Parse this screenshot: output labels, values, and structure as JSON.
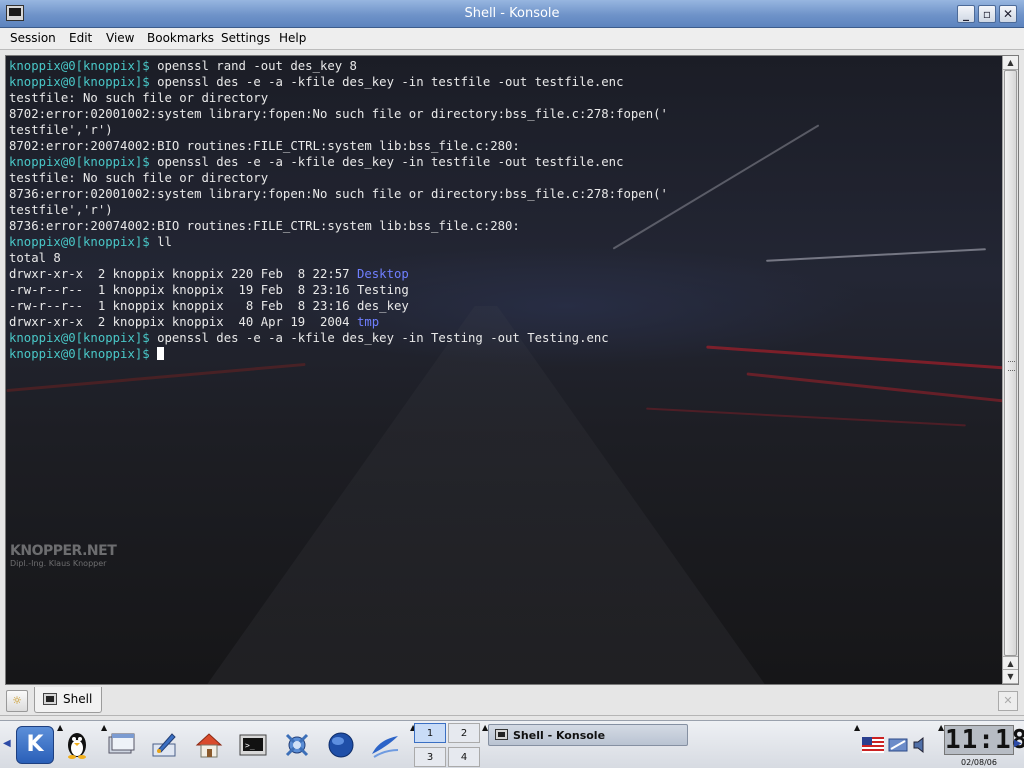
{
  "window": {
    "title": "Shell - Konsole"
  },
  "menubar": {
    "items": [
      "Session",
      "Edit",
      "View",
      "Bookmarks",
      "Settings",
      "Help"
    ]
  },
  "terminal": {
    "prompt": "knoppix@0[knoppix]$",
    "lines": [
      {
        "type": "cmd",
        "text": " openssl rand -out des_key 8"
      },
      {
        "type": "cmd",
        "text": " openssl des -e -a -kfile des_key -in testfile -out testfile.enc"
      },
      {
        "type": "out",
        "text": "testfile: No such file or directory"
      },
      {
        "type": "out",
        "text": "8702:error:02001002:system library:fopen:No such file or directory:bss_file.c:278:fopen('"
      },
      {
        "type": "out",
        "text": "testfile','r')"
      },
      {
        "type": "out",
        "text": "8702:error:20074002:BIO routines:FILE_CTRL:system lib:bss_file.c:280:"
      },
      {
        "type": "cmd",
        "text": " openssl des -e -a -kfile des_key -in testfile -out testfile.enc"
      },
      {
        "type": "out",
        "text": "testfile: No such file or directory"
      },
      {
        "type": "out",
        "text": "8736:error:02001002:system library:fopen:No such file or directory:bss_file.c:278:fopen('"
      },
      {
        "type": "out",
        "text": "testfile','r')"
      },
      {
        "type": "out",
        "text": "8736:error:20074002:BIO routines:FILE_CTRL:system lib:bss_file.c:280:"
      },
      {
        "type": "cmd",
        "text": " ll"
      },
      {
        "type": "out",
        "text": "total 8"
      },
      {
        "type": "ls",
        "text": "drwxr-xr-x  2 knoppix knoppix 220 Feb  8 22:57 ",
        "name": "Desktop",
        "isdir": true
      },
      {
        "type": "ls",
        "text": "-rw-r--r--  1 knoppix knoppix  19 Feb  8 23:16 ",
        "name": "Testing",
        "isdir": false
      },
      {
        "type": "ls",
        "text": "-rw-r--r--  1 knoppix knoppix   8 Feb  8 23:16 ",
        "name": "des_key",
        "isdir": false
      },
      {
        "type": "ls",
        "text": "drwxr-xr-x  2 knoppix knoppix  40 Apr 19  2004 ",
        "name": "tmp",
        "isdir": true
      },
      {
        "type": "cmd",
        "text": " openssl des -e -a -kfile des_key -in Testing -out Testing.enc"
      },
      {
        "type": "cursor",
        "text": " "
      }
    ],
    "watermark": {
      "brand": "KNOPPER.NET",
      "author": "Dipl.-Ing. Klaus Knopper"
    }
  },
  "tabs": [
    {
      "label": "Shell"
    }
  ],
  "panel": {
    "pager": [
      "1",
      "2",
      "3",
      "4"
    ],
    "active_desktop": "1",
    "task": {
      "label": "Shell - Konsole"
    },
    "clock": {
      "time": "11:18",
      "date": "02/08/06"
    },
    "icons": [
      "kde-menu-icon",
      "tux-icon",
      "window-list-icon",
      "kcontrol-icon",
      "home-icon",
      "terminal-icon",
      "knoppix-icon",
      "browser-icon",
      "openoffice-icon"
    ]
  }
}
